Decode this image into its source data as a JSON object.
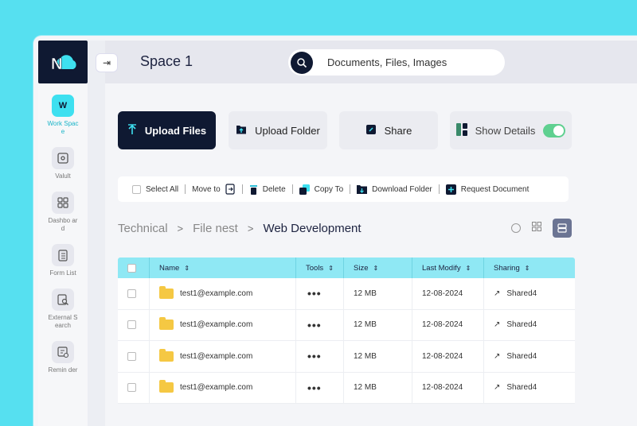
{
  "sidebar": {
    "logo_text": "N",
    "items": [
      {
        "label": "Work Space",
        "icon": "workspace-icon",
        "badge": "W",
        "active": true
      },
      {
        "label": "Valult",
        "icon": "vault-icon"
      },
      {
        "label": "Dashbo ard",
        "icon": "dashboard-icon"
      },
      {
        "label": "Form List",
        "icon": "form-list-icon"
      },
      {
        "label": "External Search",
        "icon": "external-search-icon"
      },
      {
        "label": "Remin der",
        "icon": "reminder-icon"
      }
    ]
  },
  "header": {
    "title": "Space 1",
    "search_placeholder": "Documents, Files, Images"
  },
  "actions": {
    "upload_files": "Upload Files",
    "upload_folder": "Upload Folder",
    "share": "Share",
    "show_details": "Show Details",
    "show_details_on": true
  },
  "toolbar": {
    "select_all": "Select All",
    "move_to": "Move to",
    "delete": "Delete",
    "copy_to": "Copy To",
    "download_folder": "Download Folder",
    "request_document": "Request Document"
  },
  "breadcrumb": [
    "Technical",
    "File nest",
    "Web Development"
  ],
  "table": {
    "headers": {
      "name": "Name",
      "tools": "Tools",
      "size": "Size",
      "last_modify": "Last Modify",
      "sharing": "Sharing"
    },
    "rows": [
      {
        "name": "test1@example.com",
        "tools": "•••",
        "size": "12 MB",
        "modified": "12-08-2024",
        "sharing": "Shared4"
      },
      {
        "name": "test1@example.com",
        "tools": "•••",
        "size": "12 MB",
        "modified": "12-08-2024",
        "sharing": "Shared4"
      },
      {
        "name": "test1@example.com",
        "tools": "•••",
        "size": "12 MB",
        "modified": "12-08-2024",
        "sharing": "Shared4"
      },
      {
        "name": "test1@example.com",
        "tools": "•••",
        "size": "12 MB",
        "modified": "12-08-2024",
        "sharing": "Shared4"
      }
    ]
  },
  "colors": {
    "accent": "#3ee0f0",
    "dark": "#0f1932",
    "background": "#56e0f0"
  }
}
